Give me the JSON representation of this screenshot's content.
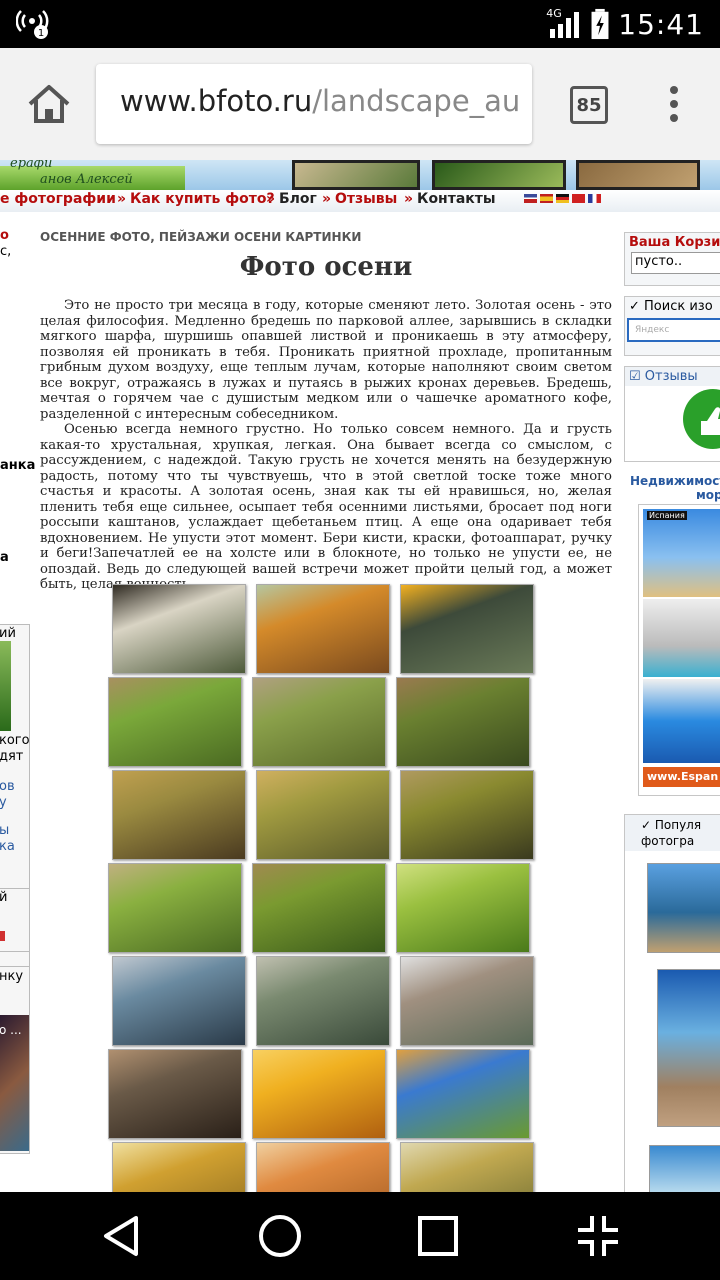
{
  "status_bar": {
    "network": "4G",
    "time": "15:41",
    "hotspot_badge": "1"
  },
  "browser": {
    "url_host": "www.bfoto.ru",
    "url_path": "/landscape_au",
    "tab_count": "85"
  },
  "site_nav": {
    "items": [
      {
        "label": "е фотографии",
        "style": "red"
      },
      {
        "label": "Как купить фото?",
        "style": "red"
      },
      {
        "label": "Блог",
        "style": "blk"
      },
      {
        "label": "Отзывы",
        "style": "red"
      },
      {
        "label": "Контакты",
        "style": "blk"
      }
    ],
    "banner_signature": "ерафи",
    "banner_signature_2": "анов Алексей"
  },
  "page": {
    "category": "ОСЕННИЕ ФОТО, ПЕЙЗАЖИ ОСЕНИ КАРТИНКИ",
    "title": "Фото осени",
    "paragraphs": [
      "Это не просто три месяца в году, которые сменяют лето. Золотая осень - это целая философия. Медленно бредешь по парковой аллее, зарывшись в складки мягкого шарфа, шуршишь опавшей листвой и проникаешь в эту атмосферу, позволяя ей проникать в тебя. Проникать приятной прохладе, пропитанным грибным духом воздуху, еще теплым лучам, которые наполняют своим светом все вокруг, отражаясь в лужах и путаясь в рыжих кронах деревьев. Бредешь, мечтая о горячем чае с душистым медком или о чашечке ароматного кофе, разделенной с интересным собеседником.",
      "Осенью всегда немного грустно. Но только совсем немного. Да и грусть какая-то хрустальная, хрупкая, легкая. Она бывает всегда со смыслом, с рассуждением, с надеждой. Такую грусть не хочется менять на безудержную радость, потому что ты чувствуешь, что в этой светлой тоске тоже много счастья и красоты. А золотая осень, зная как ты ей нравишься, но, желая пленить тебя еще сильнее, осыпает тебя осенними листьями, бросает под ноги россыпи каштанов, услаждает щебетаньем птиц. А еще она одаривает тебя вдохновением. Не упусти этот момент. Бери кисти, краски, фотоаппарат, ручку и беги!Запечатлей ее на холсте или в блокноте, но только не упусти ее, не опоздай. Ведь до следующей вашей встречи может пройти целый год, а может быть, целая вечность."
    ]
  },
  "left_fragments": {
    "f1": "о",
    "f2": "с,",
    "f3": "анка",
    "f4": "а",
    "f5": "ий",
    "f6": "кого",
    "f7": "дят",
    "f8": "ов",
    "f9": "у",
    "f10": "ы",
    "f11": "ка",
    "f12": "й",
    "f13": "нку",
    "f14": "о ..."
  },
  "right_widgets": {
    "cart_title": "Ваша Корзи",
    "cart_value": "пусто..",
    "search_title": "✓ Поиск изо",
    "search_placeholder": "Яндекс",
    "reviews_title": "☑ Отзывы",
    "realty_title_1": "Недвижимость",
    "realty_title_2": "мор",
    "realty_badge": "Испания",
    "realty_site": "www.Espan",
    "popular_title_1": "✓ Популя",
    "popular_title_2": "фотогра"
  },
  "gallery": {
    "photos": [
      {
        "name": "birch-path",
        "colors": [
          "#d9d4c4",
          "#4d5a3a",
          "#2f2a22"
        ]
      },
      {
        "name": "bench-autumn",
        "colors": [
          "#d48a2a",
          "#7a4a1e",
          "#b5c6a0"
        ]
      },
      {
        "name": "maple-leaf",
        "colors": [
          "#3d4a3a",
          "#6a7a58",
          "#f2b020"
        ]
      },
      {
        "name": "forest-road",
        "colors": [
          "#7aa83a",
          "#4b6a22",
          "#a89060"
        ]
      },
      {
        "name": "forest-stairs",
        "colors": [
          "#8aa04a",
          "#5a6a2a",
          "#b0a080"
        ]
      },
      {
        "name": "forest-path",
        "colors": [
          "#6a8030",
          "#3a4a1e",
          "#9a7a50"
        ]
      },
      {
        "name": "autumn-grove",
        "colors": [
          "#9a8a40",
          "#4a3a20",
          "#c0a050"
        ]
      },
      {
        "name": "stairs-woods",
        "colors": [
          "#a09a40",
          "#5a5a2a",
          "#d0b060"
        ]
      },
      {
        "name": "wooden-steps",
        "colors": [
          "#8a8a30",
          "#3a3a1e",
          "#b09a60"
        ]
      },
      {
        "name": "green-alley",
        "colors": [
          "#8ab040",
          "#4a6a22",
          "#c0b080"
        ]
      },
      {
        "name": "tall-trees",
        "colors": [
          "#7a9a30",
          "#3a5a1a",
          "#a08a50"
        ]
      },
      {
        "name": "grass-dew",
        "colors": [
          "#9ac040",
          "#4a7a1a",
          "#d0e080"
        ]
      },
      {
        "name": "river-branch",
        "colors": [
          "#6a8aa0",
          "#2a3a48",
          "#c0c8d0"
        ]
      },
      {
        "name": "river-valley",
        "colors": [
          "#7a8a70",
          "#3a4a3a",
          "#c0c0b0"
        ]
      },
      {
        "name": "cliff-river",
        "colors": [
          "#a09080",
          "#5a6a58",
          "#e0e0e0"
        ]
      },
      {
        "name": "mushrooms",
        "colors": [
          "#6a5a48",
          "#2a2018",
          "#b09070"
        ]
      },
      {
        "name": "golden-leaves",
        "colors": [
          "#f0b020",
          "#b06010",
          "#f8d060"
        ]
      },
      {
        "name": "park-sky",
        "colors": [
          "#3a7ad0",
          "#6a9a30",
          "#e0a040"
        ]
      },
      {
        "name": "birch-gold",
        "colors": [
          "#d0a030",
          "#8a6a20",
          "#f0e0a0"
        ]
      },
      {
        "name": "orange-grove",
        "colors": [
          "#e08a40",
          "#a05a20",
          "#f0d0a0"
        ]
      },
      {
        "name": "birch-forest",
        "colors": [
          "#c0a850",
          "#6a6a30",
          "#e0d8b0"
        ]
      }
    ]
  }
}
